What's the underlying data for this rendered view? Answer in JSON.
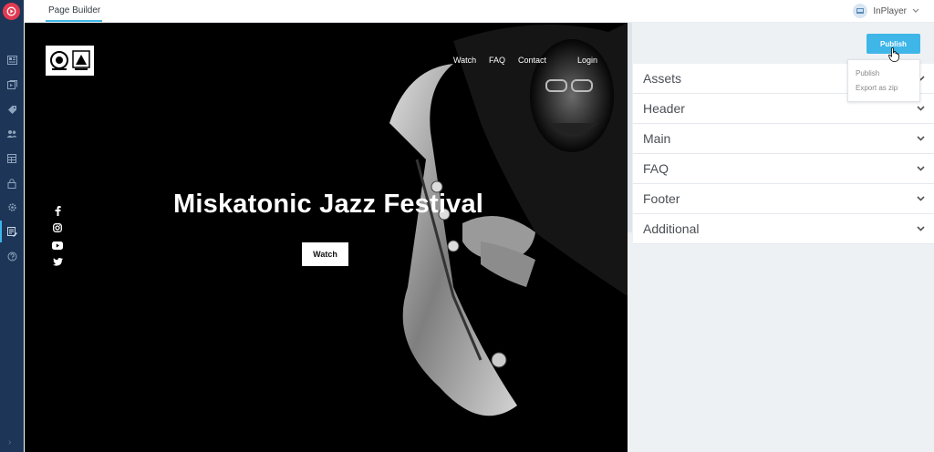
{
  "app": {
    "brand_icon": "play-logo-icon"
  },
  "sidebar": {
    "items": [
      {
        "icon": "dashboard-icon"
      },
      {
        "icon": "media-icon"
      },
      {
        "icon": "tag-icon"
      },
      {
        "icon": "users-icon"
      },
      {
        "icon": "table-icon"
      },
      {
        "icon": "lock-icon"
      },
      {
        "icon": "settings-icon"
      },
      {
        "icon": "page-builder-icon",
        "active": true
      },
      {
        "icon": "help-icon"
      }
    ],
    "expand_icon": "chevron-right-icon"
  },
  "topbar": {
    "tab_label": "Page Builder",
    "account_name": "InPlayer"
  },
  "preview": {
    "nav": [
      "Watch",
      "FAQ",
      "Contact",
      "Login"
    ],
    "hero_title": "Miskatonic Jazz Festival",
    "cta_label": "Watch",
    "social": [
      "facebook-icon",
      "instagram-icon",
      "youtube-icon",
      "twitter-icon"
    ]
  },
  "panel": {
    "publish_label": "Publish",
    "dropdown": [
      "Publish",
      "Export as zip"
    ],
    "sections": [
      "Assets",
      "Header",
      "Main",
      "FAQ",
      "Footer",
      "Additional"
    ]
  },
  "colors": {
    "sidebar": "#1d3658",
    "accent": "#3fb6e8",
    "brand": "#e23a52"
  }
}
